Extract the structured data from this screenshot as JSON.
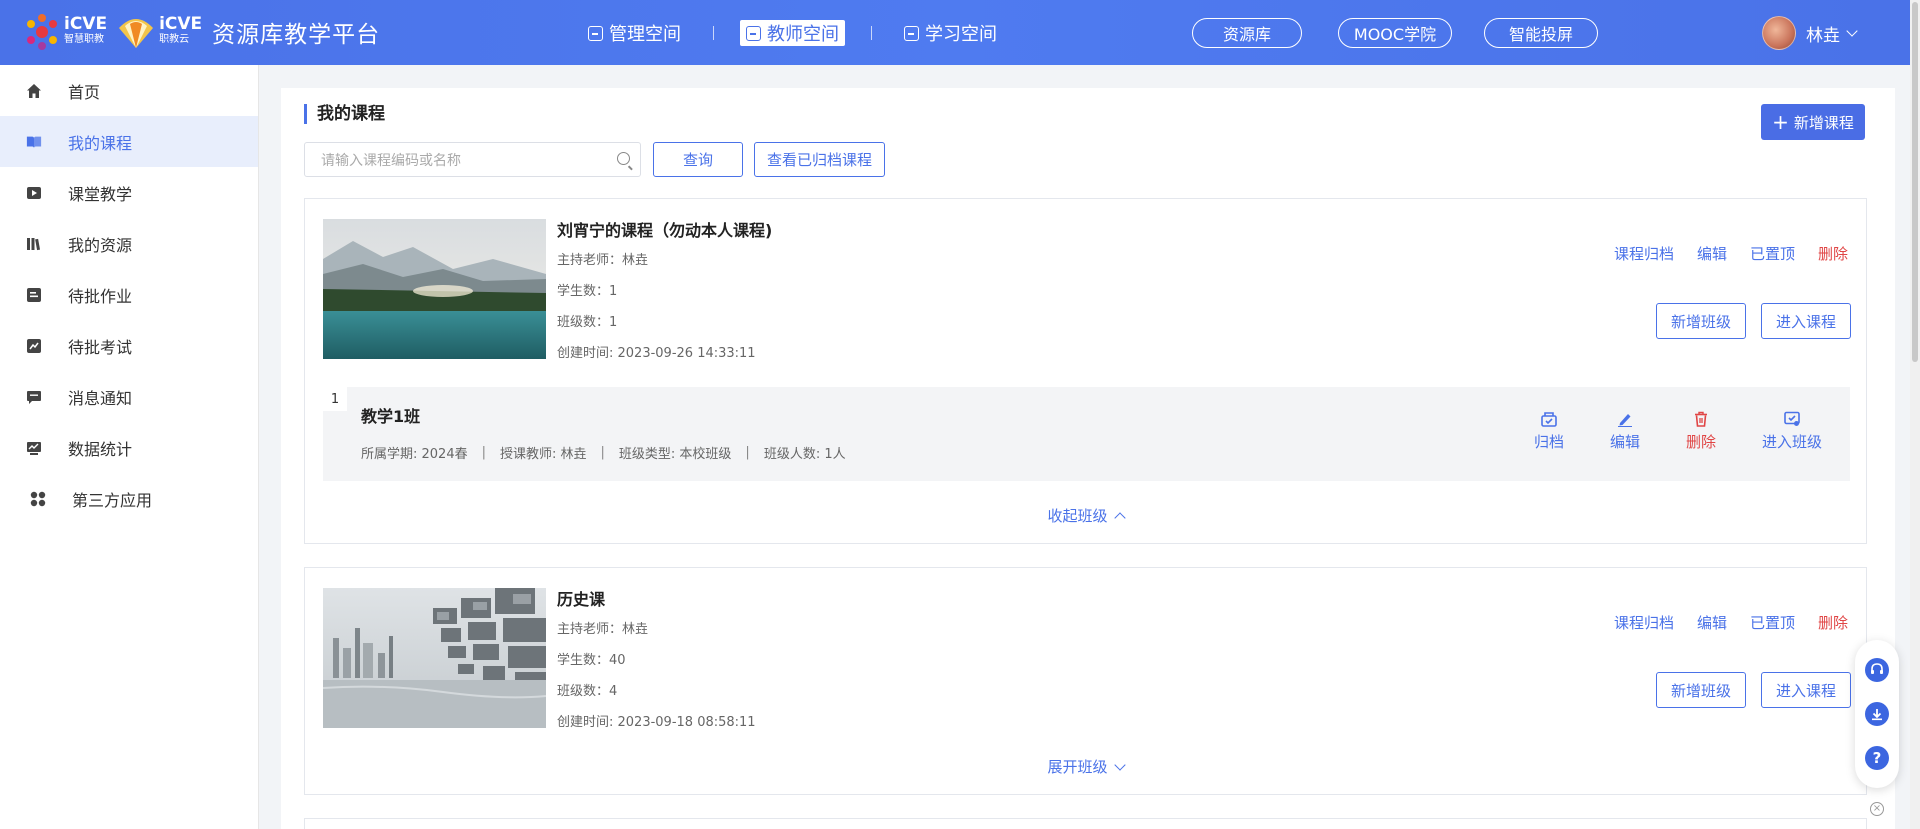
{
  "header": {
    "logo1_name": "iCVE",
    "logo1_sub": "智慧职教",
    "logo2_name": "iCVE",
    "logo2_sub": "职教云",
    "platform_title": "资源库教学平台",
    "nav": [
      {
        "label": "管理空间"
      },
      {
        "label": "教师空间"
      },
      {
        "label": "学习空间"
      }
    ],
    "pills": [
      {
        "label": "资源库"
      },
      {
        "label": "MOOC学院"
      },
      {
        "label": "智能投屏"
      }
    ],
    "user_name": "林垚"
  },
  "sidebar": {
    "items": [
      {
        "label": "首页",
        "icon": "home-icon"
      },
      {
        "label": "我的课程",
        "icon": "book-icon"
      },
      {
        "label": "课堂教学",
        "icon": "play-icon"
      },
      {
        "label": "我的资源",
        "icon": "library-icon"
      },
      {
        "label": "待批作业",
        "icon": "homework-icon"
      },
      {
        "label": "待批考试",
        "icon": "exam-icon"
      },
      {
        "label": "消息通知",
        "icon": "message-icon"
      },
      {
        "label": "数据统计",
        "icon": "stats-icon"
      },
      {
        "label": "第三方应用",
        "icon": "apps-icon"
      }
    ]
  },
  "main": {
    "title": "我的课程",
    "add_course": "新增课程",
    "search_placeholder": "请输入课程编码或名称",
    "query": "查询",
    "view_archived": "查看已归档课程",
    "courses": [
      {
        "name": "刘宵宁的课程（勿动本人课程)",
        "host": "主持老师：林垚",
        "students": "学生数：1",
        "classes": "班级数：1",
        "created": "创建时间: 2023-09-26 14:33:11",
        "actions": [
          "课程归档",
          "编辑",
          "已置顶",
          "删除"
        ],
        "btn_add_class": "新增班级",
        "btn_enter": "进入课程",
        "class_list": [
          {
            "index": "1",
            "name": "教学1班",
            "term": "所属学期: 2024春",
            "teacher": "授课教师: 林垚",
            "type": "班级类型: 本校班级",
            "count": "班级人数: 1人",
            "acts": [
              "归档",
              "编辑",
              "删除",
              "进入班级"
            ]
          }
        ],
        "toggle": "收起班级"
      },
      {
        "name": "历史课",
        "host": "主持老师：林垚",
        "students": "学生数：40",
        "classes": "班级数：4",
        "created": "创建时间: 2023-09-18 08:58:11",
        "actions": [
          "课程归档",
          "编辑",
          "已置顶",
          "删除"
        ],
        "btn_add_class": "新增班级",
        "btn_enter": "进入课程",
        "toggle": "展开班级"
      }
    ]
  },
  "colors": {
    "header": "#4a72e8",
    "accent": "#4a72e8",
    "danger": "#e04545"
  }
}
